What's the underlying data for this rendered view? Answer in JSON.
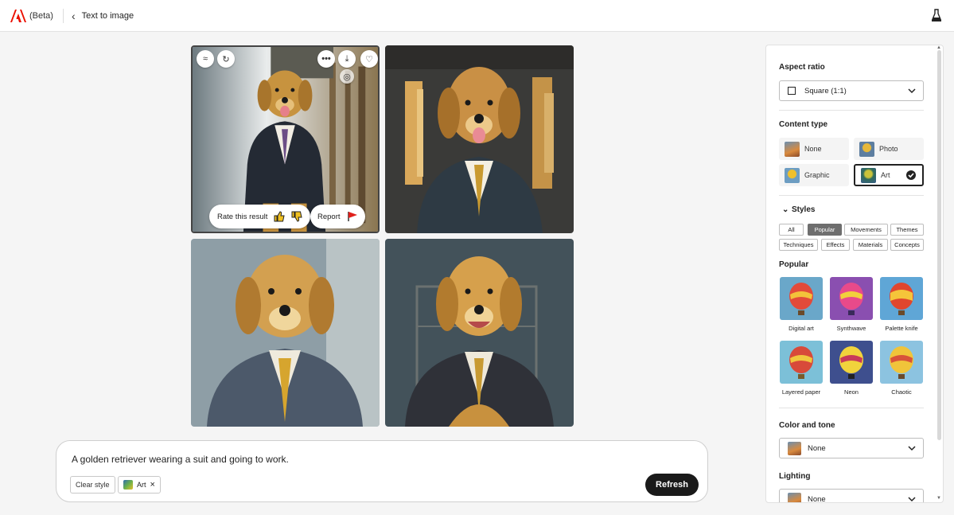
{
  "topbar": {
    "beta": "(Beta)",
    "breadcrumb": "Text to image"
  },
  "tile_actions": {
    "rate_label": "Rate this result",
    "report_label": "Report"
  },
  "prompt": {
    "text": "A golden retriever wearing a suit and going to work.",
    "clear_style": "Clear style",
    "chip_label": "Art",
    "chip_remove": "×",
    "refresh": "Refresh"
  },
  "panel": {
    "aspect_ratio_title": "Aspect ratio",
    "aspect_ratio_value": "Square (1:1)",
    "content_type_title": "Content type",
    "content_types": [
      {
        "label": "None",
        "selected": false
      },
      {
        "label": "Photo",
        "selected": false
      },
      {
        "label": "Graphic",
        "selected": false
      },
      {
        "label": "Art",
        "selected": true
      }
    ],
    "styles_title": "Styles",
    "style_tabs": [
      {
        "label": "All",
        "active": false
      },
      {
        "label": "Popular",
        "active": true
      },
      {
        "label": "Movements",
        "active": false
      },
      {
        "label": "Themes",
        "active": false
      },
      {
        "label": "Techniques",
        "active": false
      },
      {
        "label": "Effects",
        "active": false
      },
      {
        "label": "Materials",
        "active": false
      },
      {
        "label": "Concepts",
        "active": false
      }
    ],
    "popular_title": "Popular",
    "popular_styles": [
      {
        "label": "Digital art"
      },
      {
        "label": "Synthwave"
      },
      {
        "label": "Palette knife"
      },
      {
        "label": "Layered paper"
      },
      {
        "label": "Neon"
      },
      {
        "label": "Chaotic"
      }
    ],
    "color_tone_title": "Color and tone",
    "color_tone_value": "None",
    "lighting_title": "Lighting",
    "lighting_value": "None"
  },
  "colors": {
    "accent_dark": "#1a1a1a",
    "adobe_red": "#eb1000",
    "report_flag": "#e0201b"
  }
}
